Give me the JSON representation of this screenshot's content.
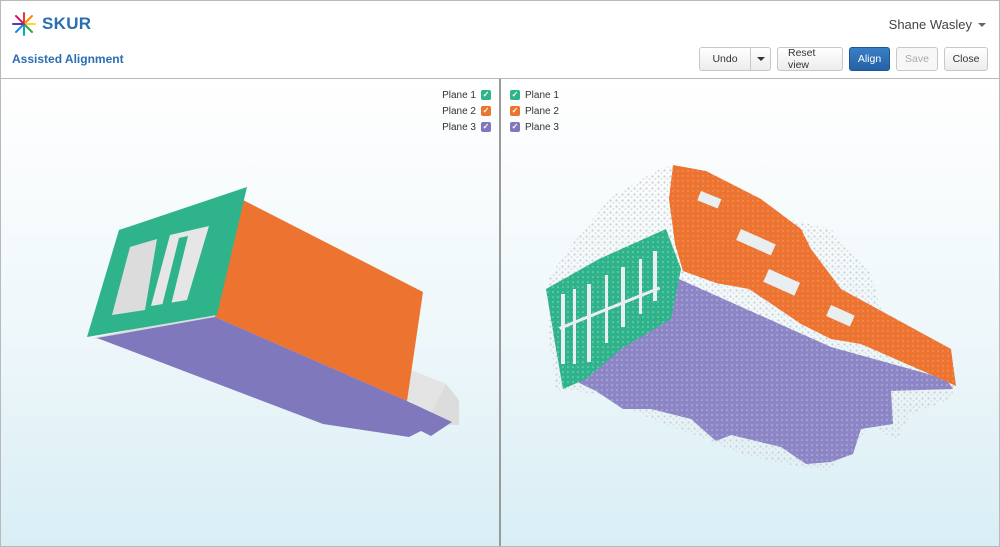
{
  "app": {
    "brand": "SKUR",
    "user_name": "Shane Wasley"
  },
  "page": {
    "title": "Assisted Alignment"
  },
  "toolbar": {
    "undo": "Undo",
    "reset": "Reset view",
    "align": "Align",
    "save": "Save",
    "close": "Close"
  },
  "legend": [
    {
      "label": "Plane 1",
      "color": "#2fb38a",
      "checked": true
    },
    {
      "label": "Plane 2",
      "color": "#ed7330",
      "checked": true
    },
    {
      "label": "Plane 3",
      "color": "#7f78bd",
      "checked": true
    }
  ],
  "colors": {
    "accent": "#2a6db3",
    "plane1": "#2fb38a",
    "plane2": "#ed7330",
    "plane3": "#7f78bd"
  }
}
